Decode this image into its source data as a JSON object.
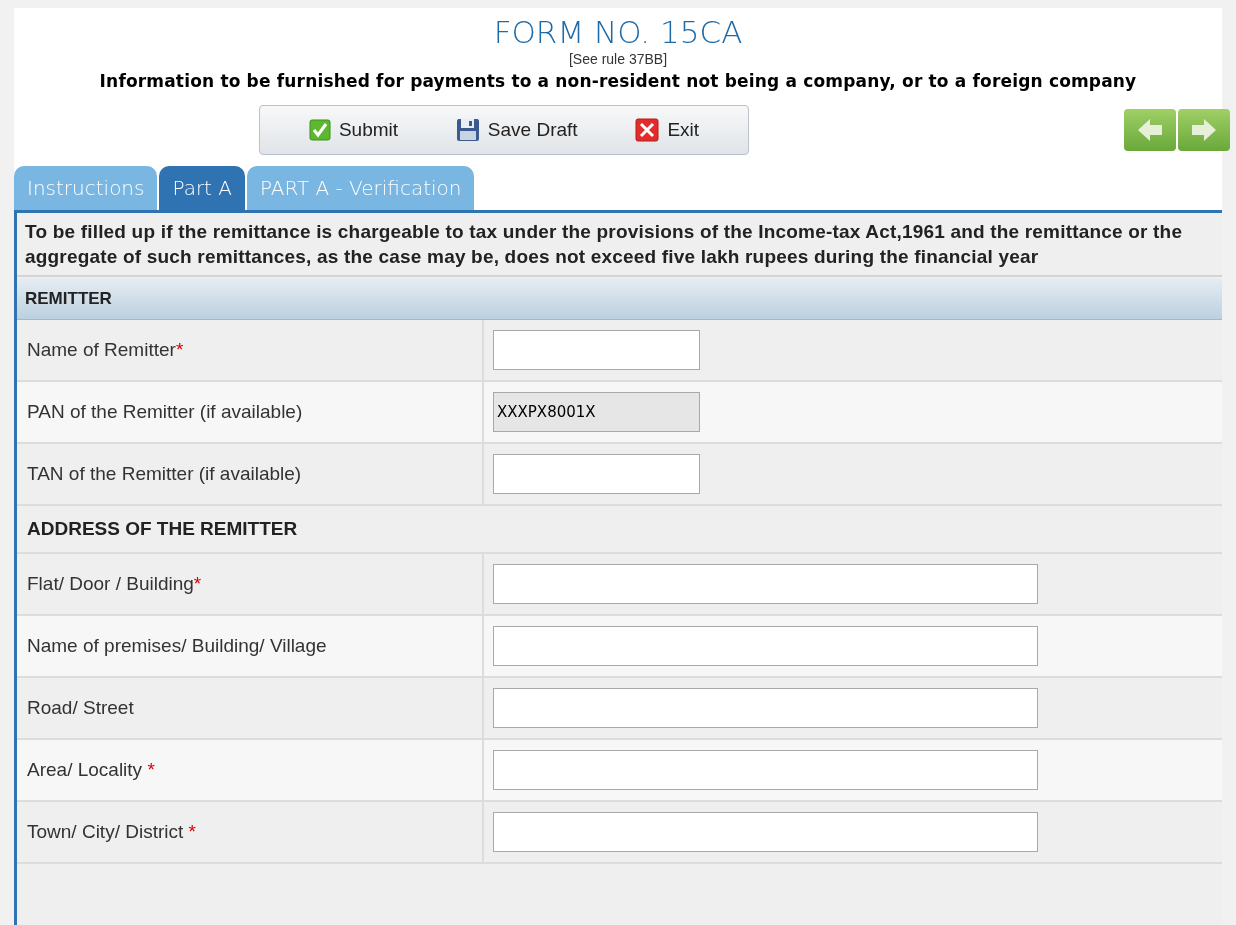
{
  "header": {
    "title": "FORM NO. 15CA",
    "rule": "[See rule 37BB]",
    "subtitle": "Information to be furnished for payments to a non-resident not being a company, or to a foreign company"
  },
  "toolbar": [
    {
      "kind": "submit",
      "label": "Submit"
    },
    {
      "kind": "save",
      "label": "Save Draft"
    },
    {
      "kind": "exit",
      "label": "Exit"
    }
  ],
  "nav": [
    {
      "kind": "back"
    },
    {
      "kind": "forward"
    }
  ],
  "tabs": [
    {
      "label": "Instructions",
      "selected": false
    },
    {
      "label": "Part A",
      "selected": true
    },
    {
      "label": "PART A - Verification",
      "selected": false
    }
  ],
  "intro": "To be filled up if the remittance is chargeable to tax under the provisions of the Income-tax Act,1961 and the remittance or the aggregate of such remittances, as the case may be, does not exceed five lakh rupees during the financial year",
  "section": "REMITTER",
  "rows": [
    {
      "kind": "code",
      "label": "Name of Remitter",
      "mark": "*",
      "disabled": false
    },
    {
      "kind": "code",
      "label": "PAN of the Remitter (if available)",
      "disabled": true,
      "value": "XXXPX8001X"
    },
    {
      "kind": "code",
      "label": "TAN of the Remitter (if available)",
      "disabled": false
    },
    {
      "kind": "heading",
      "label": "ADDRESS OF THE REMITTER"
    },
    {
      "kind": "address",
      "label": "Flat/ Door / Building",
      "mark": "*",
      "disabled": false
    },
    {
      "kind": "address",
      "label": "Name of premises/ Building/ Village",
      "disabled": false
    },
    {
      "kind": "address",
      "label": "Road/ Street",
      "disabled": false
    },
    {
      "kind": "address",
      "label": "Area/ Locality ",
      "mark": "*",
      "disabled": false
    },
    {
      "kind": "address",
      "label": "Town/ City/ District ",
      "mark": "*",
      "disabled": false
    }
  ]
}
